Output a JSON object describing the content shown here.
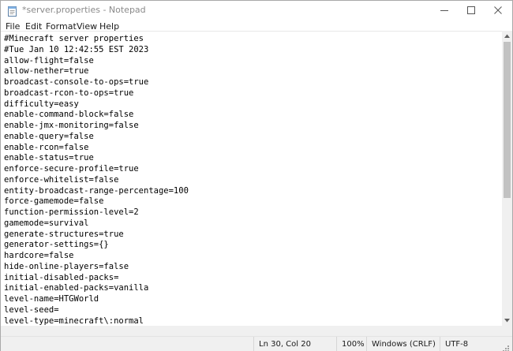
{
  "window": {
    "title": "*server.properties - Notepad"
  },
  "menu": [
    "File",
    "Edit",
    "Format",
    "View",
    "Help"
  ],
  "editor": {
    "lines": [
      "#Minecraft server properties",
      "#Tue Jan 10 12:42:55 EST 2023",
      "allow-flight=false",
      "allow-nether=true",
      "broadcast-console-to-ops=true",
      "broadcast-rcon-to-ops=true",
      "difficulty=easy",
      "enable-command-block=false",
      "enable-jmx-monitoring=false",
      "enable-query=false",
      "enable-rcon=false",
      "enable-status=true",
      "enforce-secure-profile=true",
      "enforce-whitelist=false",
      "entity-broadcast-range-percentage=100",
      "force-gamemode=false",
      "function-permission-level=2",
      "gamemode=survival",
      "generate-structures=true",
      "generator-settings={}",
      "hardcore=false",
      "hide-online-players=false",
      "initial-disabled-packs=",
      "initial-enabled-packs=vanilla",
      "level-name=HTGWorld",
      "level-seed=",
      "level-type=minecraft\\:normal"
    ]
  },
  "status": {
    "position": "Ln 30, Col 20",
    "zoom": "100%",
    "line_ending": "Windows (CRLF)",
    "encoding": "UTF-8"
  },
  "colors": {
    "chrome": "#f0f0f0",
    "scroll_thumb": "#c2c2c2",
    "title_text": "#8a8a8a"
  },
  "icons": {
    "app": "notepad-icon",
    "minimize": "minimize-icon",
    "maximize": "maximize-icon",
    "close": "close-icon",
    "scroll_up": "chevron-up-icon",
    "scroll_down": "chevron-down-icon",
    "grip": "resize-grip-icon"
  }
}
